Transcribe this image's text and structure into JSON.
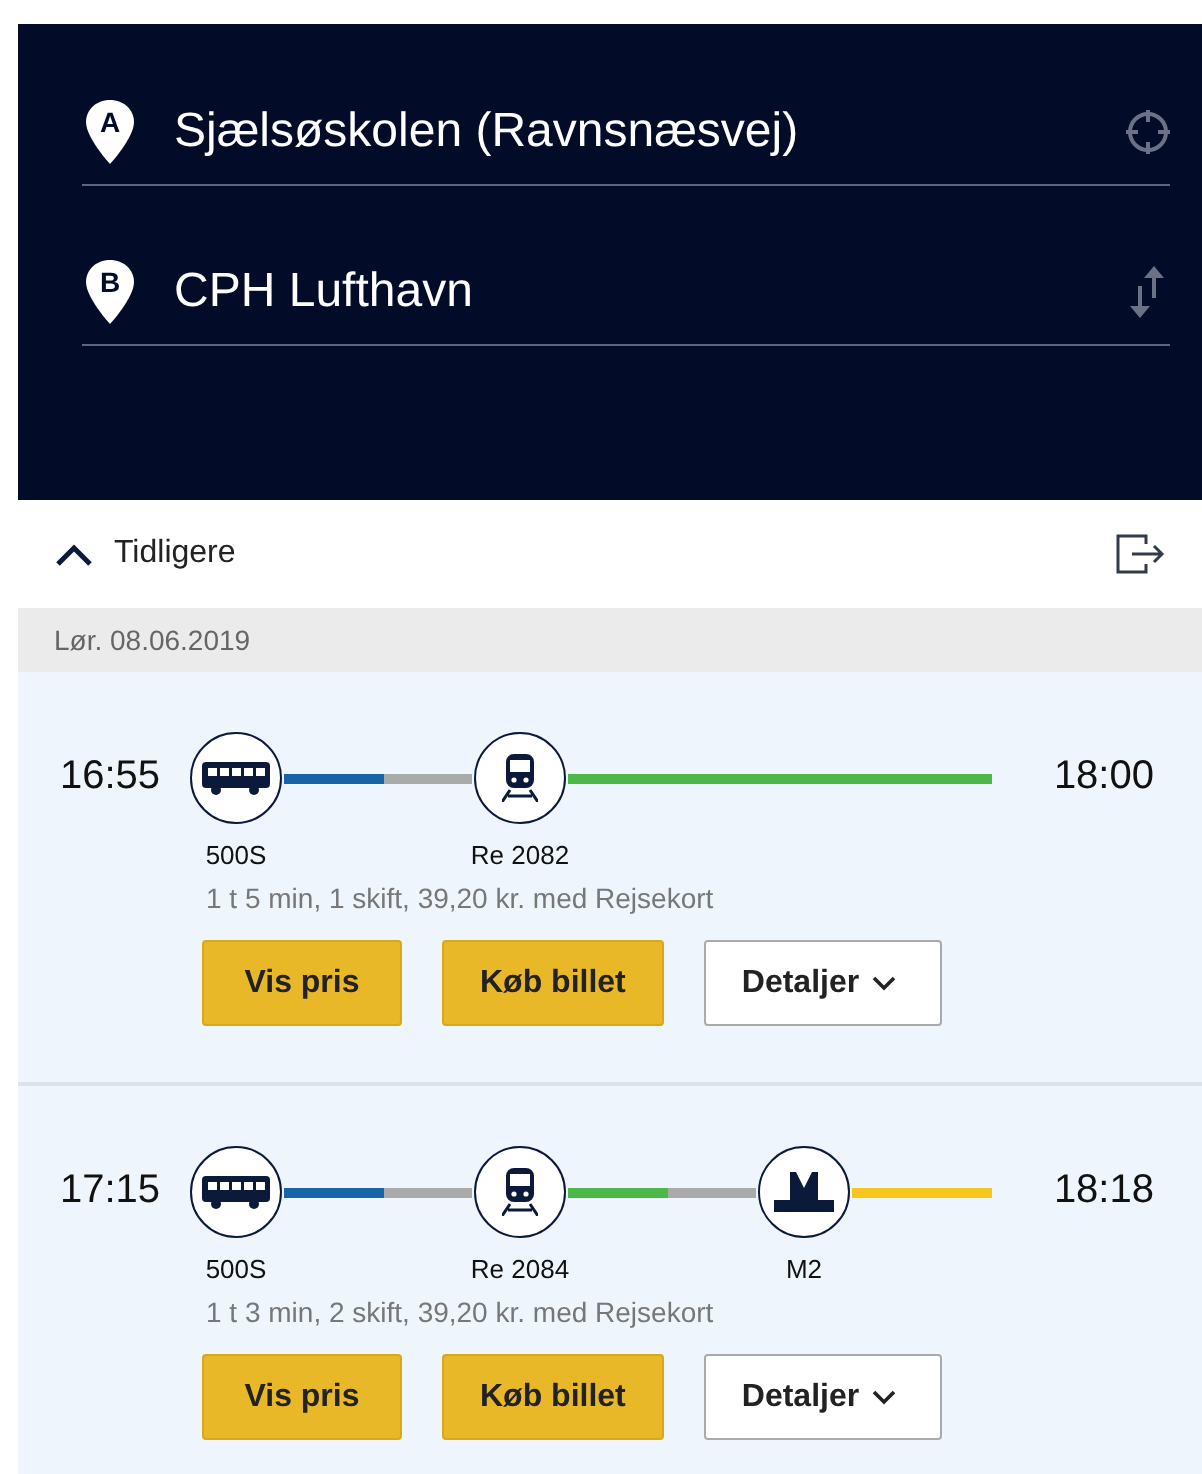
{
  "search": {
    "from": "Sjælsøskolen (Ravnsnæsvej)",
    "from_marker": "A",
    "to": "CPH Lufthavn",
    "to_marker": "B"
  },
  "earlier": {
    "label": "Tidligere"
  },
  "date": "Lør. 08.06.2019",
  "trips": [
    {
      "departure": "16:55",
      "arrival": "18:00",
      "summary": "1 t 5 min, 1 skift, 39,20 kr. med Rejsekort",
      "legs": [
        {
          "kind": "bus",
          "label": "500S",
          "color": "#1565a8"
        },
        {
          "kind": "train",
          "label": "Re 2082",
          "color": "#4cb848"
        }
      ],
      "buttons": [
        "Vis pris",
        "Køb billet"
      ],
      "details": "Detaljer"
    },
    {
      "departure": "17:15",
      "arrival": "18:18",
      "summary": "1 t 3 min, 2 skift, 39,20 kr. med Rejsekort",
      "legs": [
        {
          "kind": "bus",
          "label": "500S",
          "color": "#1565a8"
        },
        {
          "kind": "train",
          "label": "Re 2084",
          "color": "#4cb848"
        },
        {
          "kind": "metro",
          "label": "M2",
          "color": "#f8c51c"
        }
      ],
      "buttons": [
        "Vis pris",
        "Køb billet"
      ],
      "details": "Detaljer"
    }
  ]
}
